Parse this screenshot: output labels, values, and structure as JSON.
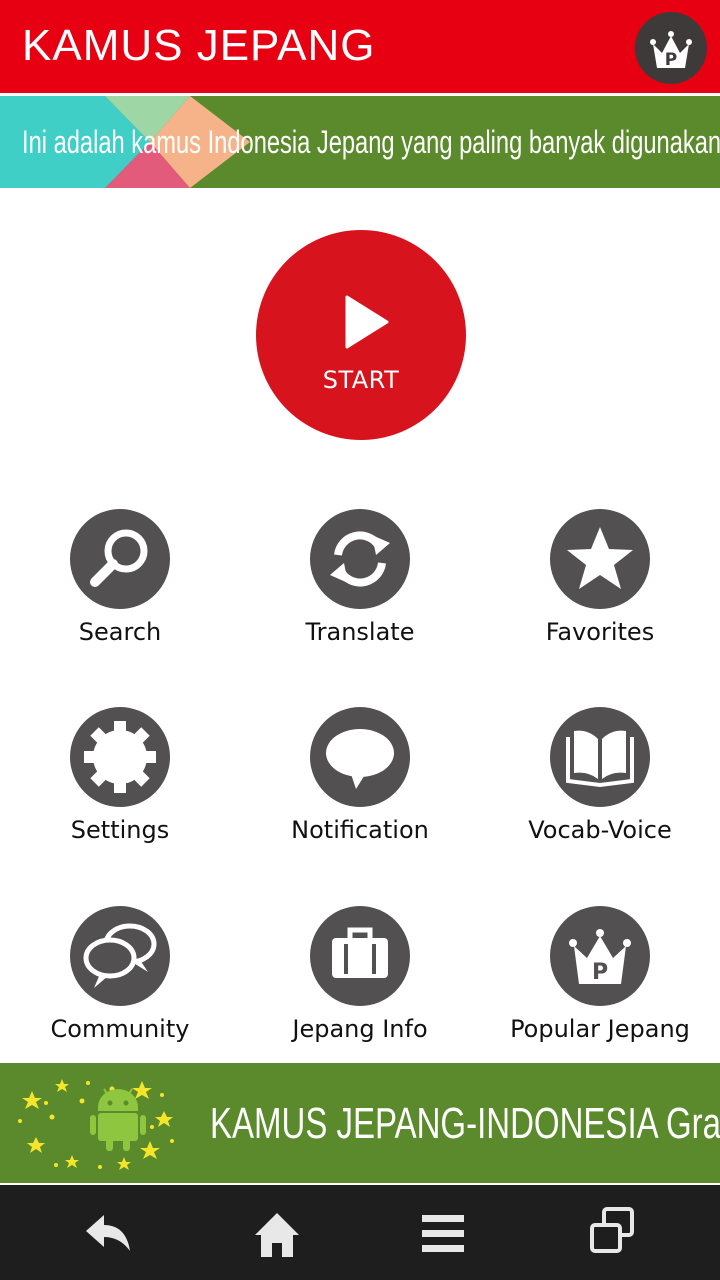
{
  "header": {
    "title": "KAMUS JEPANG",
    "badge_icon": "popular-crown-p-icon",
    "badge_letter": "P"
  },
  "banner": {
    "text": "Ini adalah kamus Indonesia Jepang yang paling banyak digunakan di dunia."
  },
  "start": {
    "label": "START",
    "icon": "play-icon"
  },
  "menu": [
    {
      "label": "Search",
      "icon": "magnifier-icon"
    },
    {
      "label": "Translate",
      "icon": "refresh-arrows-icon"
    },
    {
      "label": "Favorites",
      "icon": "star-icon"
    },
    {
      "label": "Settings",
      "icon": "gear-icon"
    },
    {
      "label": "Notification",
      "icon": "speech-bubble-icon"
    },
    {
      "label": "Vocab-Voice",
      "icon": "open-book-icon"
    },
    {
      "label": "Community",
      "icon": "chat-bubbles-icon"
    },
    {
      "label": "Jepang Info",
      "icon": "briefcase-icon"
    },
    {
      "label": "Popular Jepang",
      "icon": "crown-p-icon"
    }
  ],
  "ad": {
    "text": "KAMUS JEPANG-INDONESIA Gratis",
    "icon": "android-stars-icon"
  },
  "navbar": [
    {
      "icon": "back-icon"
    },
    {
      "icon": "home-icon"
    },
    {
      "icon": "menu-icon"
    },
    {
      "icon": "recent-apps-icon"
    }
  ],
  "colors": {
    "header_red": "#e60012",
    "start_red": "#d7141e",
    "banner_green": "#5a8a2b",
    "icon_gray": "#525050",
    "navbar_dark": "#1e1e1e"
  }
}
